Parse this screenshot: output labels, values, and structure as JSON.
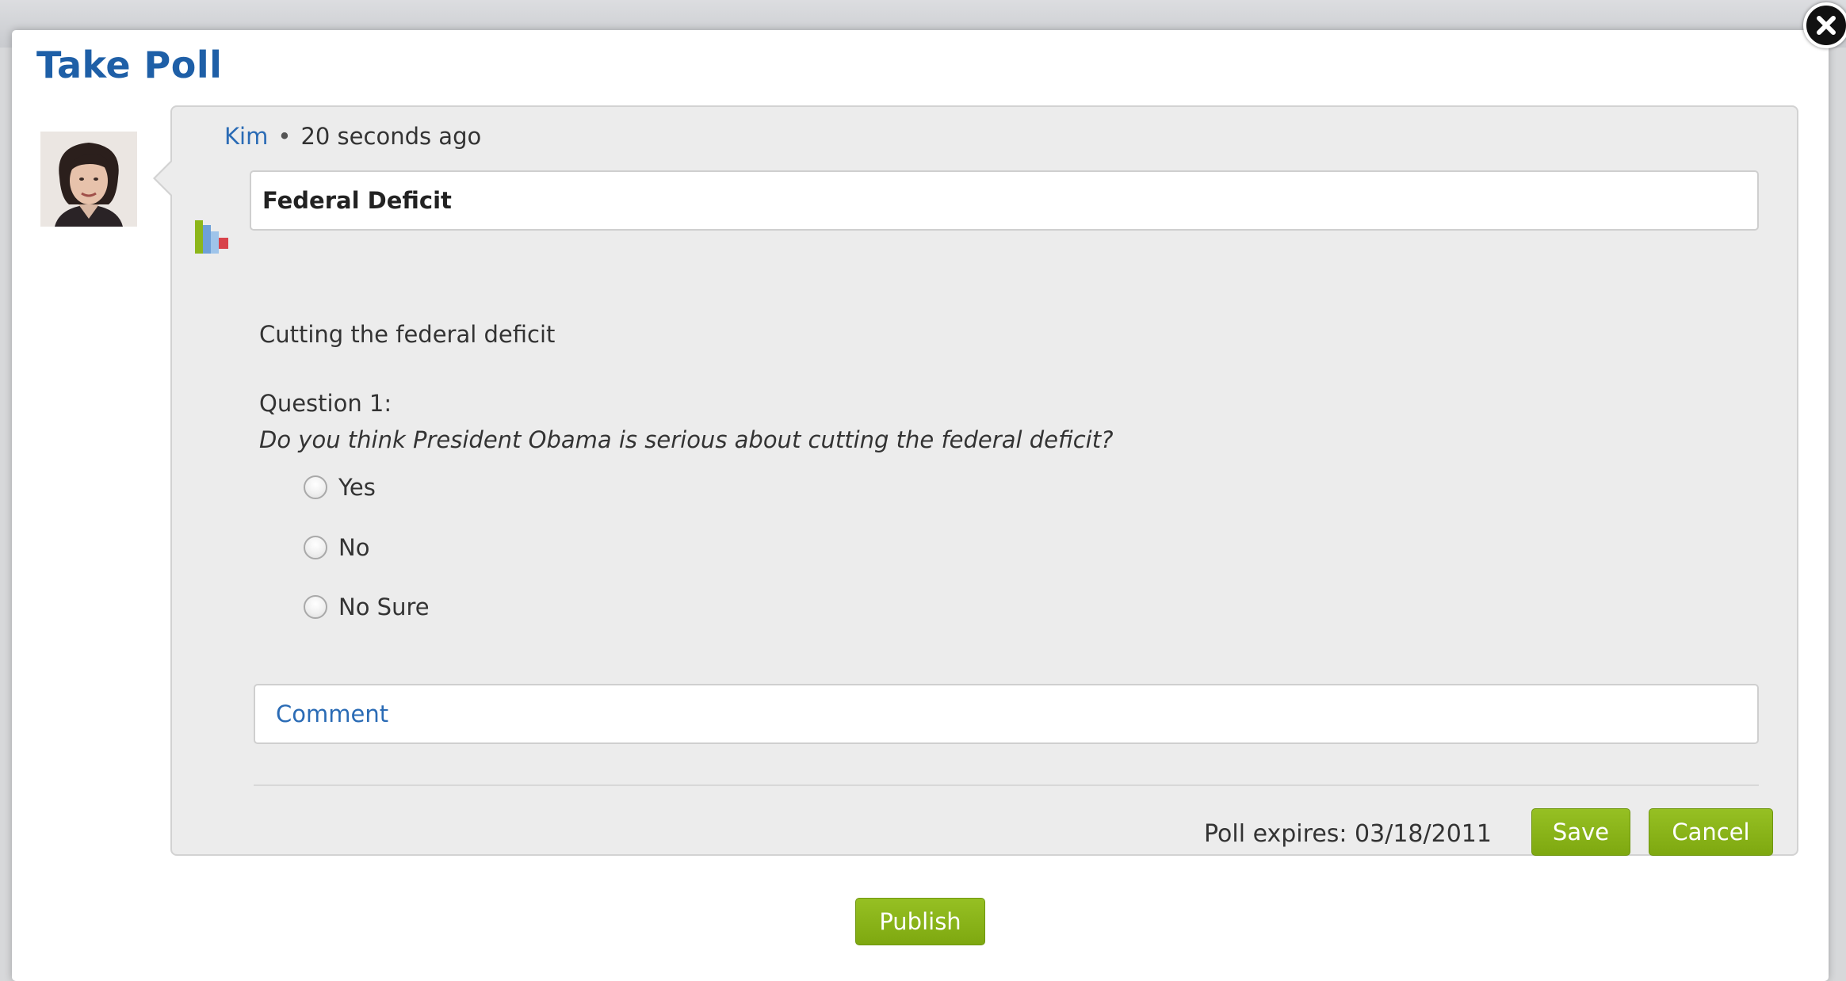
{
  "dialog": {
    "title": "Take Poll"
  },
  "post": {
    "author": "Kim",
    "separator": "•",
    "timestamp": "20 seconds ago",
    "avatar_alt": "Kim avatar"
  },
  "poll": {
    "title": "Federal Deficit",
    "description": "Cutting the federal deficit",
    "question_label": "Question 1:",
    "question_text": "Do you think President Obama is serious about cutting the federal deficit?",
    "options": [
      {
        "label": "Yes",
        "selected": false
      },
      {
        "label": "No",
        "selected": false
      },
      {
        "label": "No Sure",
        "selected": false
      }
    ],
    "comment_placeholder": "Comment",
    "expires_text": "Poll expires: 03/18/2011"
  },
  "buttons": {
    "save": "Save",
    "cancel": "Cancel",
    "publish": "Publish"
  },
  "icons": {
    "close": "close-icon",
    "poll": "poll-chart-icon"
  },
  "colors": {
    "accent_blue": "#1e5fa7",
    "button_green": "#8cb61a",
    "card_bg": "#ececec"
  }
}
